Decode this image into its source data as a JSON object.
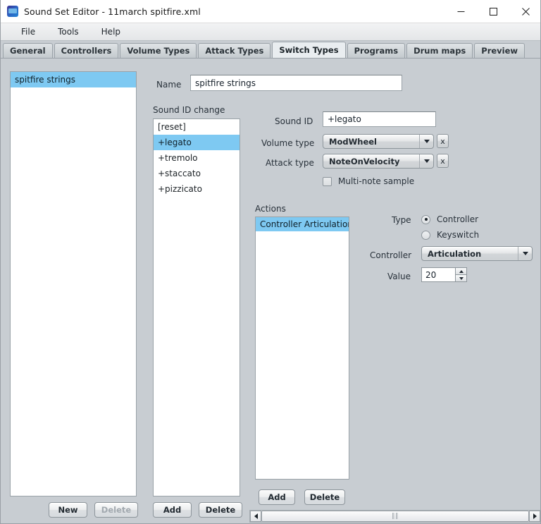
{
  "window": {
    "title": "Sound Set Editor - 11march spitfire.xml",
    "app_icon": "soundset-app-icon",
    "minimize_label": "—",
    "maximize_label": "☐",
    "close_label": "✕"
  },
  "menubar": {
    "items": [
      {
        "label": "File"
      },
      {
        "label": "Tools"
      },
      {
        "label": "Help"
      }
    ]
  },
  "tabs": [
    {
      "label": "General",
      "active": false
    },
    {
      "label": "Controllers",
      "active": false
    },
    {
      "label": "Volume Types",
      "active": false
    },
    {
      "label": "Attack Types",
      "active": false
    },
    {
      "label": "Switch Types",
      "active": true
    },
    {
      "label": "Programs",
      "active": false
    },
    {
      "label": "Drum maps",
      "active": false
    },
    {
      "label": "Preview",
      "active": false
    }
  ],
  "switch_types_list": {
    "items": [
      {
        "label": "spitfire strings",
        "selected": true
      }
    ],
    "buttons": {
      "new_label": "New",
      "delete_label": "Delete",
      "delete_enabled": false
    }
  },
  "name_field": {
    "label": "Name",
    "value": "spitfire strings"
  },
  "sound_id_change": {
    "group_label": "Sound ID change",
    "items": [
      {
        "label": "[reset]",
        "selected": false
      },
      {
        "label": "+legato",
        "selected": true
      },
      {
        "label": "+tremolo",
        "selected": false
      },
      {
        "label": "+staccato",
        "selected": false
      },
      {
        "label": "+pizzicato",
        "selected": false
      }
    ],
    "buttons": {
      "add_label": "Add",
      "delete_label": "Delete"
    }
  },
  "details": {
    "sound_id_label": "Sound ID",
    "sound_id_value": "+legato",
    "volume_type_label": "Volume type",
    "volume_type_value": "ModWheel",
    "volume_type_clear": "x",
    "attack_type_label": "Attack type",
    "attack_type_value": "NoteOnVelocity",
    "attack_type_clear": "x",
    "multi_note_label": "Multi-note sample",
    "multi_note_checked": false
  },
  "actions": {
    "group_label": "Actions",
    "items": [
      {
        "label": "Controller Articulation",
        "selected": true
      }
    ],
    "buttons": {
      "add_label": "Add",
      "delete_label": "Delete"
    },
    "type_label": "Type",
    "type_options": [
      {
        "label": "Controller",
        "selected": true
      },
      {
        "label": "Keyswitch",
        "selected": false
      }
    ],
    "controller_label": "Controller",
    "controller_value": "Articulation",
    "value_label": "Value",
    "value_number": "20"
  },
  "scrollbar": {
    "left_arrow": "scroll-left-arrow",
    "right_arrow": "scroll-right-arrow",
    "grip": "‖‖"
  },
  "colors": {
    "panel": "#c8cdd2",
    "selection": "#7ec9f2",
    "tab_active": "#e9edf0",
    "text": "#28313a"
  }
}
